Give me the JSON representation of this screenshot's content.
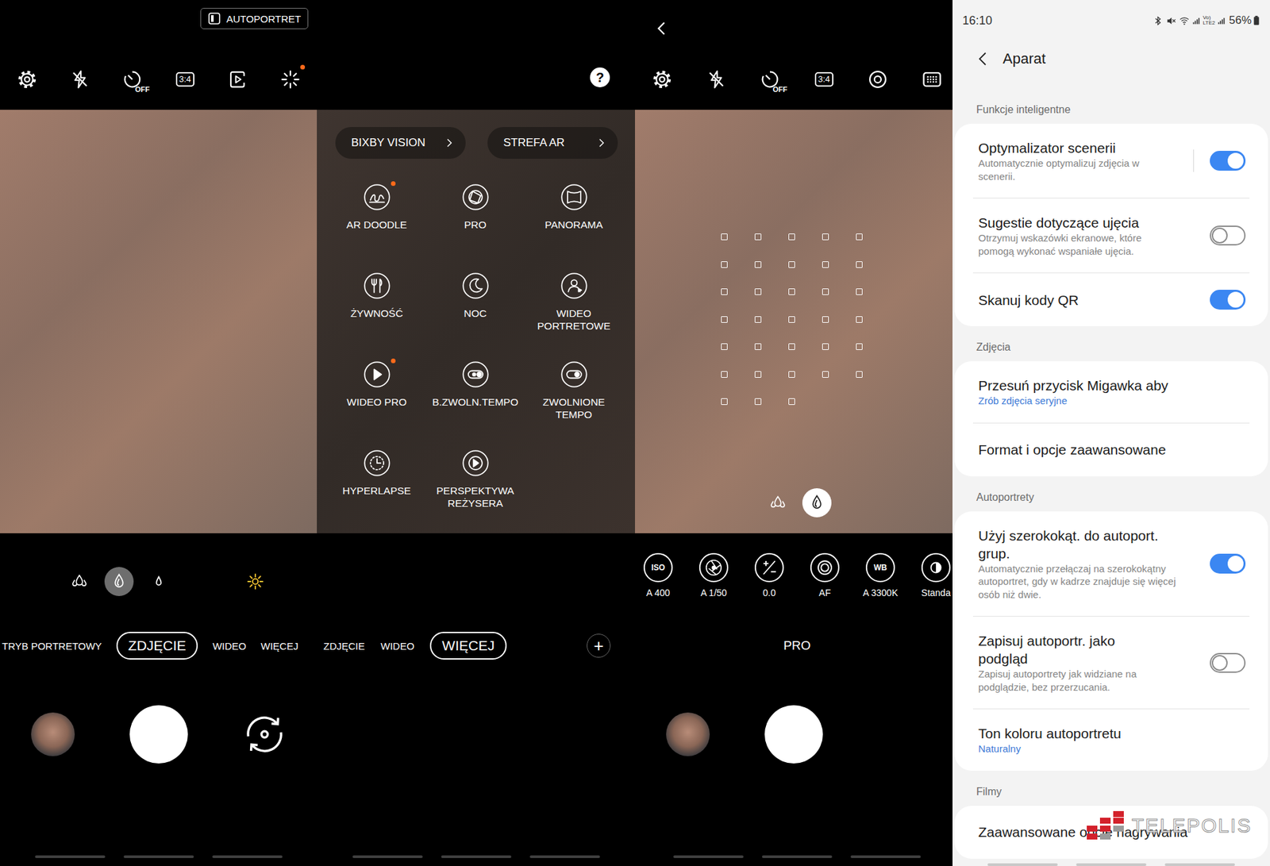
{
  "photo_screen": {
    "badge": "AUTOPORTRET",
    "toolbar": [
      {
        "kind": "settings",
        "dot": false
      },
      {
        "kind": "flash-off",
        "dot": false
      },
      {
        "kind": "timer",
        "text": "OFF",
        "dot": false
      },
      {
        "kind": "ratio",
        "text": "3:4",
        "dot": false
      },
      {
        "kind": "motion-photo",
        "dot": false
      },
      {
        "kind": "effects",
        "dot": true
      }
    ],
    "bokeh": [
      {
        "kind": "drop-large",
        "selected": false
      },
      {
        "kind": "drop-medium",
        "selected": true
      },
      {
        "kind": "drop-small",
        "selected": false
      },
      {
        "kind": "sun",
        "selected": false
      }
    ],
    "modes": [
      {
        "label": "TRYB PORTRETOWY",
        "selected": false
      },
      {
        "label": "ZDJĘCIE",
        "selected": true
      },
      {
        "label": "WIDEO",
        "selected": false
      },
      {
        "label": "WIĘCEJ",
        "selected": false
      }
    ],
    "controls": [
      {
        "kind": "gallery"
      },
      {
        "kind": "shutter"
      },
      {
        "kind": "switch-camera"
      }
    ]
  },
  "more_screen": {
    "help": "?",
    "shortcuts": [
      {
        "label": "BIXBY VISION"
      },
      {
        "label": "STREFA AR"
      }
    ],
    "grid": [
      {
        "label": "AR DOODLE",
        "kind": "doodle",
        "dot": true
      },
      {
        "label": "PRO",
        "kind": "aperture",
        "dot": false
      },
      {
        "label": "PANORAMA",
        "kind": "panorama",
        "dot": false
      },
      {
        "label": "ŻYWNOŚĆ",
        "kind": "food",
        "dot": false
      },
      {
        "label": "NOC",
        "kind": "night",
        "dot": false
      },
      {
        "label": "WIDEO PORTRETOWE",
        "kind": "portrait-video",
        "dot": false
      },
      {
        "label": "WIDEO PRO",
        "kind": "video-pro",
        "dot": true
      },
      {
        "label": "B.ZWOLN.TEMPO",
        "kind": "super-slow",
        "dot": false
      },
      {
        "label": "ZWOLNIONE TEMPO",
        "kind": "slow",
        "dot": false
      },
      {
        "label": "HYPERLAPSE",
        "kind": "hyperlapse",
        "dot": false
      },
      {
        "label": "PERSPEKTYWA REŻYSERA",
        "kind": "director",
        "dot": false
      }
    ],
    "modes": [
      {
        "label": "ZDJĘCIE",
        "selected": false
      },
      {
        "label": "WIDEO",
        "selected": false
      },
      {
        "label": "WIĘCEJ",
        "selected": true
      }
    ],
    "add_button": "+"
  },
  "pro_screen": {
    "toolbar": [
      {
        "kind": "settings",
        "dot": false
      },
      {
        "kind": "flash-off",
        "dot": false
      },
      {
        "kind": "timer",
        "text": "OFF",
        "dot": false
      },
      {
        "kind": "ratio",
        "text": "3:4",
        "dot": false
      },
      {
        "kind": "focus-ring",
        "dot": false
      },
      {
        "kind": "grid",
        "dot": false
      }
    ],
    "af_grid": {
      "columns": 5,
      "points": 33
    },
    "bokeh": [
      {
        "kind": "drop-large",
        "selected": false
      },
      {
        "kind": "drop-medium",
        "selected": true
      }
    ],
    "pro_controls": [
      {
        "kind": "iso",
        "badge": "ISO",
        "value": "A 400"
      },
      {
        "kind": "shutter",
        "value": "A 1/50"
      },
      {
        "kind": "ev",
        "value": "0.0"
      },
      {
        "kind": "focus",
        "value": "AF"
      },
      {
        "kind": "wb",
        "badge": "WB",
        "value": "A 3300K"
      },
      {
        "kind": "tone",
        "value": "Standa"
      }
    ],
    "mode": "PRO",
    "controls": [
      {
        "kind": "gallery"
      },
      {
        "kind": "shutter"
      }
    ]
  },
  "settings_screen": {
    "status": {
      "time": "16:10",
      "network": [
        "Vo)",
        "LTE2"
      ],
      "battery": "56%"
    },
    "title": "Aparat",
    "sections": [
      {
        "title": "Funkcje inteligentne",
        "rows": [
          {
            "kind": "toggle",
            "title": "Optymalizator scenerii",
            "subtitle": "Automatycznie optymalizuj zdjęcia w scenerii.",
            "on": true,
            "divider": true
          },
          {
            "kind": "toggle",
            "title": "Sugestie dotyczące ujęcia",
            "subtitle": "Otrzymuj wskazówki ekranowe, które pomogą wykonać wspaniałe ujęcia.",
            "on": false,
            "divider": false
          },
          {
            "kind": "toggle",
            "title": "Skanuj kody QR",
            "on": true,
            "divider": false
          }
        ]
      },
      {
        "title": "Zdjęcia",
        "rows": [
          {
            "kind": "link",
            "title": "Przesuń przycisk Migawka aby",
            "value": "Zrób zdjęcia seryjne"
          },
          {
            "kind": "link",
            "title": "Format i opcje zaawansowane"
          }
        ]
      },
      {
        "title": "Autoportrety",
        "rows": [
          {
            "kind": "toggle",
            "title": "Użyj szerokokąt. do autoport. grup.",
            "subtitle": "Automatycznie przełączaj na szerokokątny autoportret, gdy w kadrze znajduje się więcej osób niż dwie.",
            "on": true,
            "divider": false
          },
          {
            "kind": "toggle",
            "title": "Zapisuj autoportr. jako podgląd",
            "subtitle": "Zapisuj autoportrety jak widziane na podglądzie, bez przerzucania.",
            "on": false,
            "divider": false
          },
          {
            "kind": "link",
            "title": "Ton koloru autoportretu",
            "value": "Naturalny"
          }
        ]
      },
      {
        "title": "Filmy",
        "rows": [
          {
            "kind": "link",
            "title": "Zaawansowane opcje nagrywania"
          }
        ]
      }
    ],
    "watermark": "TELEPOLIS"
  }
}
